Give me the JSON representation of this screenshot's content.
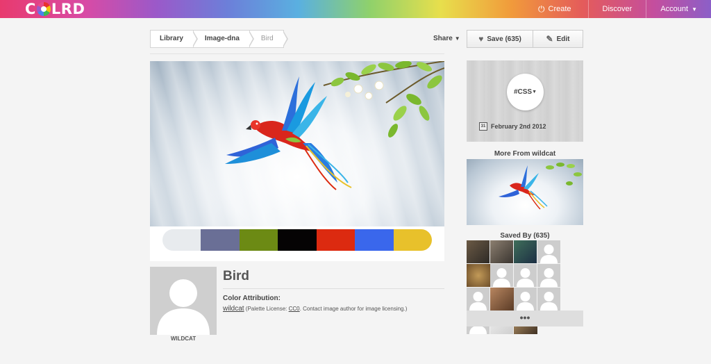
{
  "brand": {
    "logo_pre": "C",
    "logo_post": "LRD"
  },
  "nav": {
    "create": "Create",
    "discover": "Discover",
    "account": "Account"
  },
  "breadcrumb": [
    "Library",
    "Image-dna",
    "Bird"
  ],
  "toolbar": {
    "share": "Share",
    "save": "Save (635)",
    "edit": "Edit"
  },
  "palette": {
    "swatches": [
      "#e8ebee",
      "#6a6f96",
      "#6c8a14",
      "#050304",
      "#dc2a10",
      "#3a67ec",
      "#e8c12b"
    ]
  },
  "item": {
    "title": "Bird",
    "author": "WILDCAT",
    "attribution_heading": "Color Attribution:",
    "attribution_user": "wildcat",
    "attribution_prefix": " (Palette License: ",
    "license": "CC0",
    "attribution_suffix": ". Contact image author for image licensing.)"
  },
  "sidebar": {
    "tag": "#CSS",
    "date": "February 2nd 2012",
    "calendar_day": "31",
    "more_heading": "More From wildcat",
    "saved_heading": "Saved By (635)",
    "more_label": "•••"
  },
  "icons": {
    "create": "power-icon",
    "save": "heart-icon",
    "edit": "pencil-icon",
    "date": "calendar-icon"
  }
}
